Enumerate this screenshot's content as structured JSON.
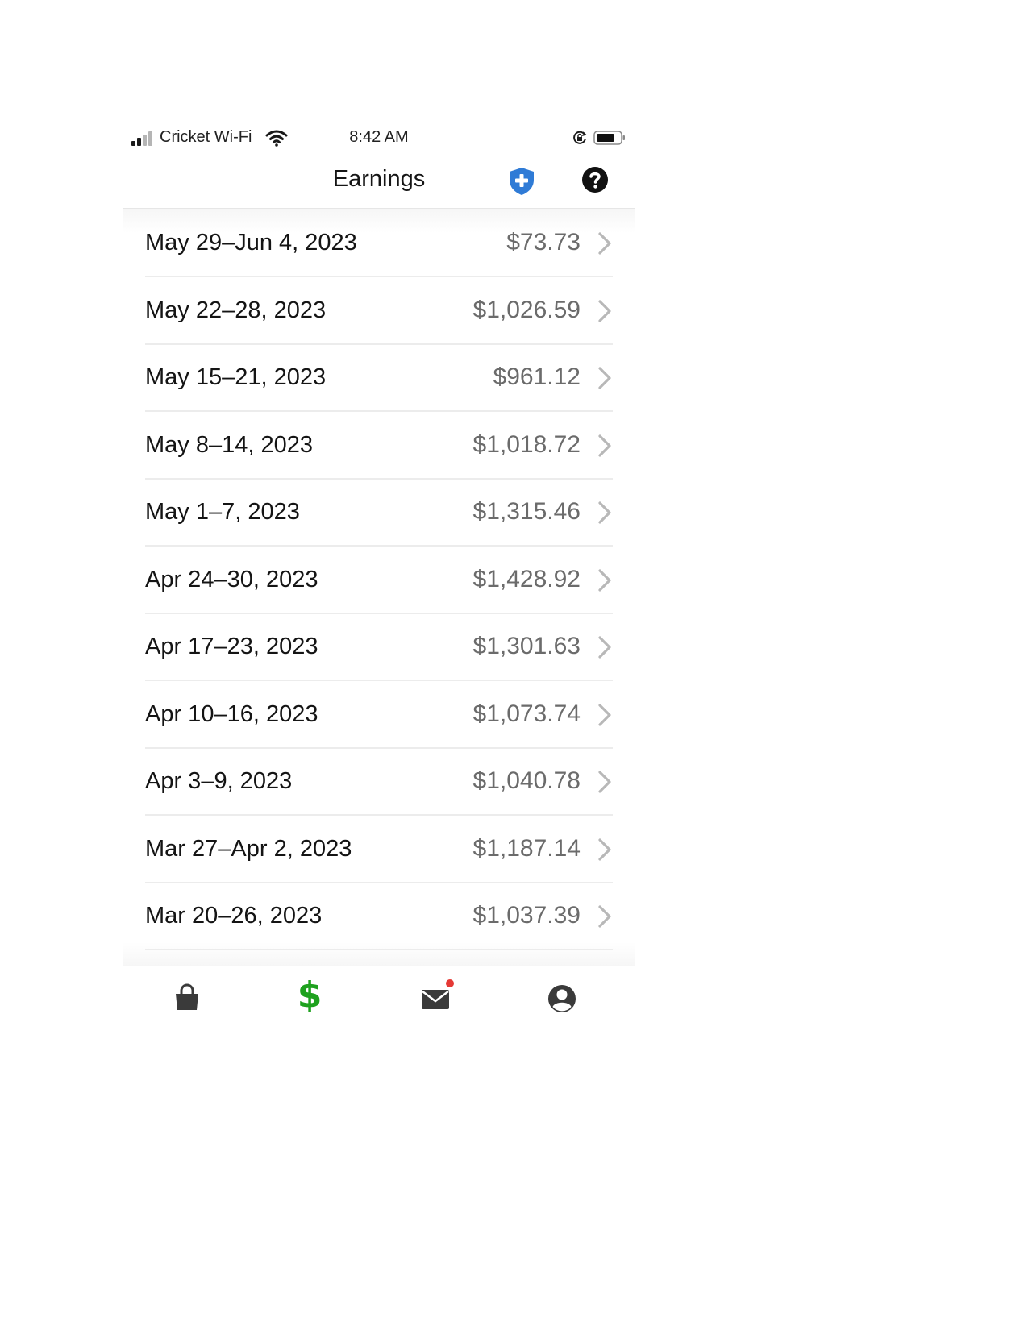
{
  "status_bar": {
    "carrier": "Cricket Wi-Fi",
    "time": "8:42 AM",
    "signal_bars_filled": 2,
    "signal_bars_total": 4
  },
  "header": {
    "title": "Earnings",
    "shield_icon": "shield-plus-icon",
    "help_icon": "question-circle-icon",
    "shield_color": "#2f7bd6"
  },
  "earnings": [
    {
      "period": "May 29–Jun 4, 2023",
      "amount": "$73.73"
    },
    {
      "period": "May 22–28, 2023",
      "amount": "$1,026.59"
    },
    {
      "period": "May 15–21, 2023",
      "amount": "$961.12"
    },
    {
      "period": "May 8–14, 2023",
      "amount": "$1,018.72"
    },
    {
      "period": "May 1–7, 2023",
      "amount": "$1,315.46"
    },
    {
      "period": "Apr 24–30, 2023",
      "amount": "$1,428.92"
    },
    {
      "period": "Apr 17–23, 2023",
      "amount": "$1,301.63"
    },
    {
      "period": "Apr 10–16, 2023",
      "amount": "$1,073.74"
    },
    {
      "period": "Apr 3–9, 2023",
      "amount": "$1,040.78"
    },
    {
      "period": "Mar 27–Apr 2, 2023",
      "amount": "$1,187.14"
    },
    {
      "period": "Mar 20–26, 2023",
      "amount": "$1,037.39"
    }
  ],
  "tab_bar": {
    "tabs": [
      {
        "icon": "shopping-bag-icon",
        "active": false
      },
      {
        "icon": "dollar-sign-icon",
        "symbol": "$",
        "active": true
      },
      {
        "icon": "mail-icon",
        "active": false,
        "has_badge": true
      },
      {
        "icon": "account-icon",
        "active": false
      }
    ],
    "active_color": "#1ea11e",
    "badge_color": "#e53935"
  }
}
